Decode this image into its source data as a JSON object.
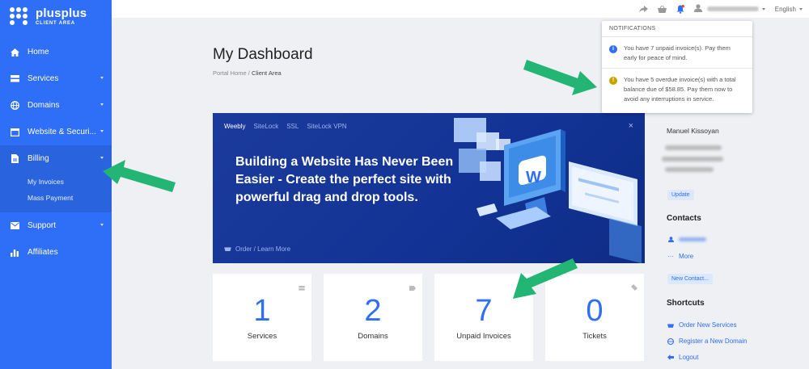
{
  "brand": {
    "name": "plusplus",
    "sub": "CLIENT AREA"
  },
  "sidebar": {
    "items": [
      {
        "label": "Home"
      },
      {
        "label": "Services"
      },
      {
        "label": "Domains"
      },
      {
        "label": "Website & Securi..."
      },
      {
        "label": "Billing"
      },
      {
        "label": "Support"
      },
      {
        "label": "Affiliates"
      }
    ],
    "billing_sub": [
      "My Invoices",
      "Mass Payment"
    ]
  },
  "topbar": {
    "language": "English"
  },
  "page": {
    "title": "My Dashboard",
    "breadcrumb_home": "Portal Home",
    "breadcrumb_sep": "/",
    "breadcrumb_current": "Client Area"
  },
  "banner": {
    "tabs": [
      "Weebly",
      "SiteLock",
      "SSL",
      "SiteLock VPN"
    ],
    "heading": "Building a Website Has Never Been Easier - Create the perfect site with powerful drag and drop tools.",
    "link": "Order / Learn More",
    "close": "×"
  },
  "stats": [
    {
      "value": "1",
      "label": "Services"
    },
    {
      "value": "2",
      "label": "Domains"
    },
    {
      "value": "7",
      "label": "Unpaid Invoices"
    },
    {
      "value": "0",
      "label": "Tickets"
    }
  ],
  "account": {
    "name": "Manuel Kissoyan",
    "update": "Update",
    "contacts_heading": "Contacts",
    "more": "More",
    "new_contact": "New Contact...",
    "shortcuts_heading": "Shortcuts",
    "shortcuts": [
      "Order New Services",
      "Register a New Domain",
      "Logout"
    ]
  },
  "notifications": {
    "heading": "NOTIFICATIONS",
    "items": [
      {
        "text": "You have 7 unpaid invoice(s). Pay them early for peace of mind.",
        "color": "#2f6ef6",
        "icon": "info-icon"
      },
      {
        "text": "You have 5 overdue invoice(s) with a total balance due of $58.85. Pay them now to avoid any interruptions in service.",
        "color": "#c9a100",
        "icon": "warning-icon"
      }
    ]
  },
  "colors": {
    "sidebar": "#2f6ef6",
    "accent": "#2f6ef6",
    "arrow": "#22b573",
    "banner": "#123395"
  }
}
